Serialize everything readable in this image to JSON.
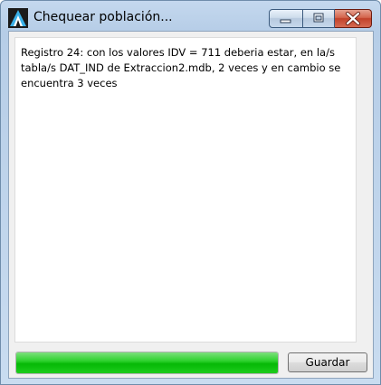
{
  "window": {
    "title": "Chequear población...",
    "app_icon": "app-logo-icon"
  },
  "caption_buttons": {
    "minimize_icon": "minimize-icon",
    "maximize_icon": "maximize-icon",
    "close_icon": "close-icon",
    "close_color": "#c7432b"
  },
  "message": {
    "text": "Registro 24: con los valores IDV = 711 deberia estar, en la/s tabla/s DAT_IND de Extraccion2.mdb, 2 veces y en cambio se encuentra 3 veces"
  },
  "progress": {
    "value_percent": 100,
    "color": "#06b906"
  },
  "actions": {
    "save_label": "Guardar"
  }
}
